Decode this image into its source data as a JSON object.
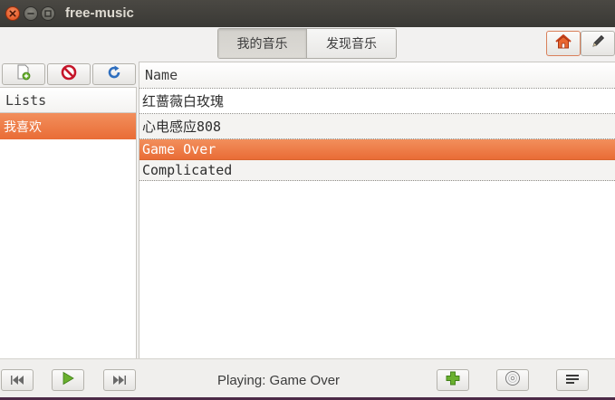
{
  "window": {
    "title": "free-music",
    "controls": [
      "close-icon",
      "minimize-icon",
      "maximize-icon"
    ]
  },
  "header": {
    "tabs": [
      {
        "label": "我的音乐",
        "selected": true
      },
      {
        "label": "发现音乐",
        "selected": false
      }
    ],
    "actions": [
      "home-icon",
      "edit-pencil-icon"
    ]
  },
  "sidebar": {
    "toolbar": [
      "add-list-icon",
      "delete-list-icon",
      "refresh-icon"
    ],
    "header": "Lists",
    "items": [
      {
        "label": "我喜欢",
        "selected": true
      }
    ]
  },
  "songs": {
    "column_header": "Name",
    "rows": [
      {
        "name": "红蔷薇白玫瑰",
        "selected": false
      },
      {
        "name": "心电感应808",
        "selected": false
      },
      {
        "name": "Game Over",
        "selected": true
      },
      {
        "name": "Complicated",
        "selected": false
      }
    ]
  },
  "player": {
    "status": "Playing: Game Over",
    "controls": [
      "previous-icon",
      "play-icon",
      "next-icon"
    ],
    "right_controls": [
      "add-icon",
      "disc-icon",
      "playlist-icon"
    ]
  },
  "colors": {
    "accent": "#ec7a42",
    "titlebar": "#3c3b37"
  }
}
